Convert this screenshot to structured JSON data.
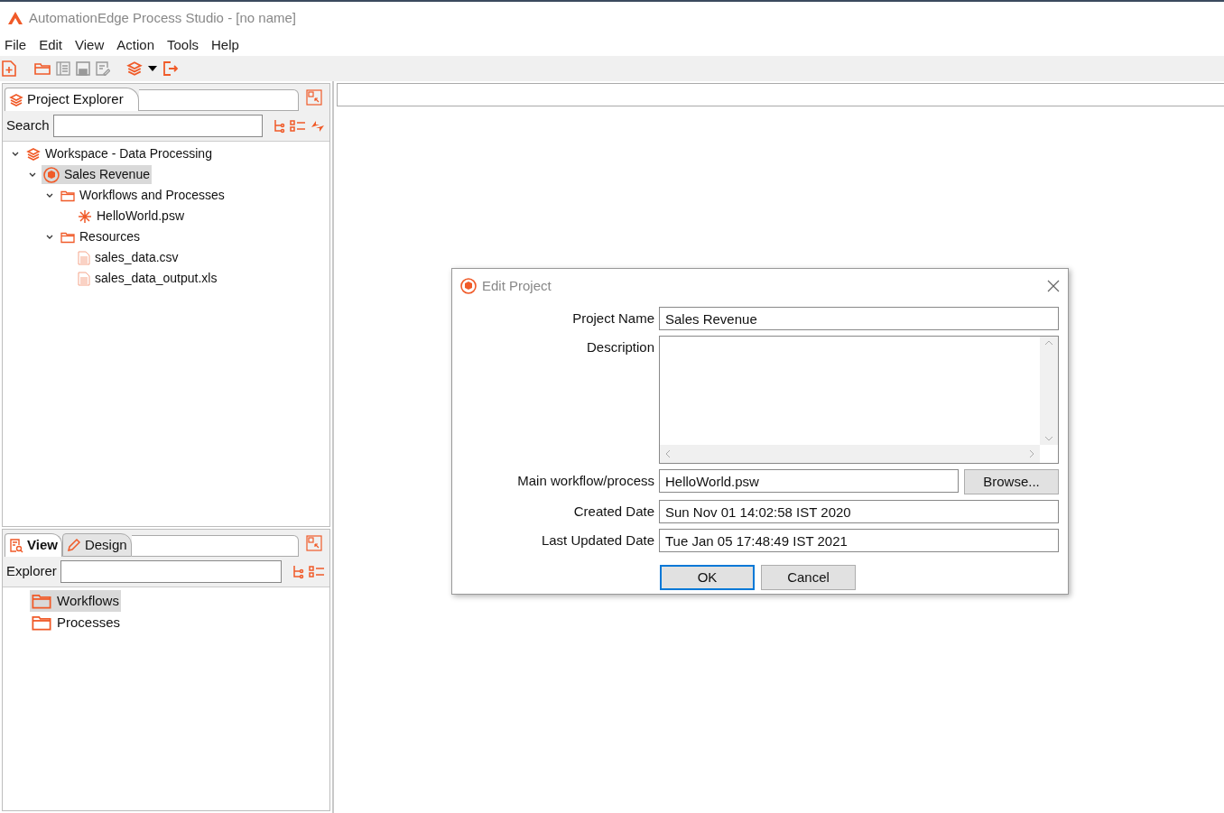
{
  "window": {
    "title": "AutomationEdge Process Studio - [no name]"
  },
  "menu": [
    "File",
    "Edit",
    "View",
    "Action",
    "Tools",
    "Help"
  ],
  "project_explorer": {
    "tab": "Project Explorer",
    "search_label": "Search",
    "tree": [
      {
        "label": "Workspace - Data Processing",
        "kind": "workspace",
        "expanded": true,
        "selected": false,
        "children": [
          {
            "label": "Sales Revenue",
            "kind": "project",
            "expanded": true,
            "selected": true,
            "children": [
              {
                "label": "Workflows and Processes",
                "kind": "folder",
                "expanded": true,
                "selected": false,
                "children": [
                  {
                    "label": "HelloWorld.psw",
                    "kind": "workflow",
                    "selected": false
                  }
                ]
              },
              {
                "label": "Resources",
                "kind": "folder",
                "expanded": true,
                "selected": false,
                "children": [
                  {
                    "label": "sales_data.csv",
                    "kind": "file",
                    "selected": false
                  },
                  {
                    "label": "sales_data_output.xls",
                    "kind": "file",
                    "selected": false
                  }
                ]
              }
            ]
          }
        ]
      }
    ]
  },
  "view_panel": {
    "tabs": [
      {
        "label": "View",
        "kind": "view",
        "selected": true
      },
      {
        "label": "Design",
        "kind": "design",
        "selected": false
      }
    ],
    "explorer_label": "Explorer",
    "items": [
      {
        "label": "Workflows",
        "selected": true
      },
      {
        "label": "Processes",
        "selected": false
      }
    ]
  },
  "dialog": {
    "title": "Edit Project",
    "fields": [
      {
        "label": "Project Name",
        "kind": "text",
        "value": "Sales Revenue"
      },
      {
        "label": "Description",
        "kind": "textarea"
      },
      {
        "label": "Main workflow/process",
        "kind": "browse",
        "value": "HelloWorld.psw",
        "button": "Browse..."
      },
      {
        "label": "Created Date",
        "kind": "text",
        "value": "Sun Nov 01 14:02:58 IST 2020"
      },
      {
        "label": "Last Updated Date",
        "kind": "text",
        "value": "Tue Jan 05 17:48:49 IST 2021"
      }
    ],
    "buttons": [
      {
        "label": "OK",
        "selected": true
      },
      {
        "label": "Cancel",
        "selected": false
      }
    ]
  }
}
